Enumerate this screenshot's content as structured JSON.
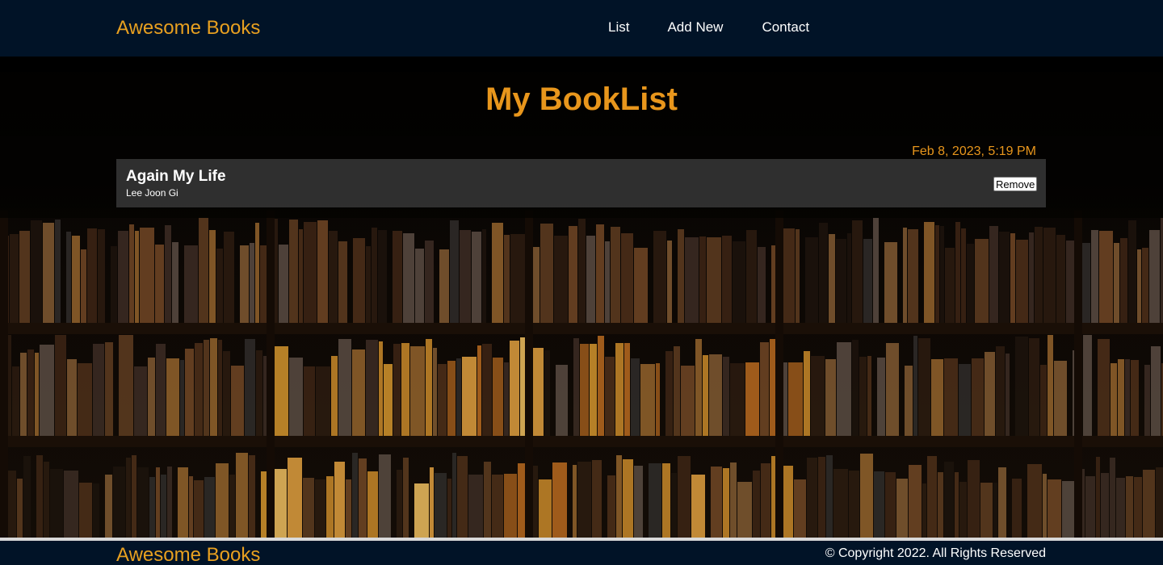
{
  "header": {
    "brand": "Awesome Books",
    "nav": [
      "List",
      "Add New",
      "Contact"
    ]
  },
  "main": {
    "title": "My BookList",
    "timestamp": "Feb 8, 2023, 5:19 PM",
    "books": [
      {
        "title": "Again My Life",
        "author": "Lee Joon Gi",
        "remove_label": "Remove"
      }
    ]
  },
  "footer": {
    "brand": "Awesome Books",
    "copyright": "© Copyright 2022. All Rights Reserved"
  },
  "colors": {
    "header_bg": "#011327",
    "accent": "#e8961c",
    "card_bg": "#3c3c3c"
  },
  "background": {
    "image": "bookshelf-photo"
  }
}
